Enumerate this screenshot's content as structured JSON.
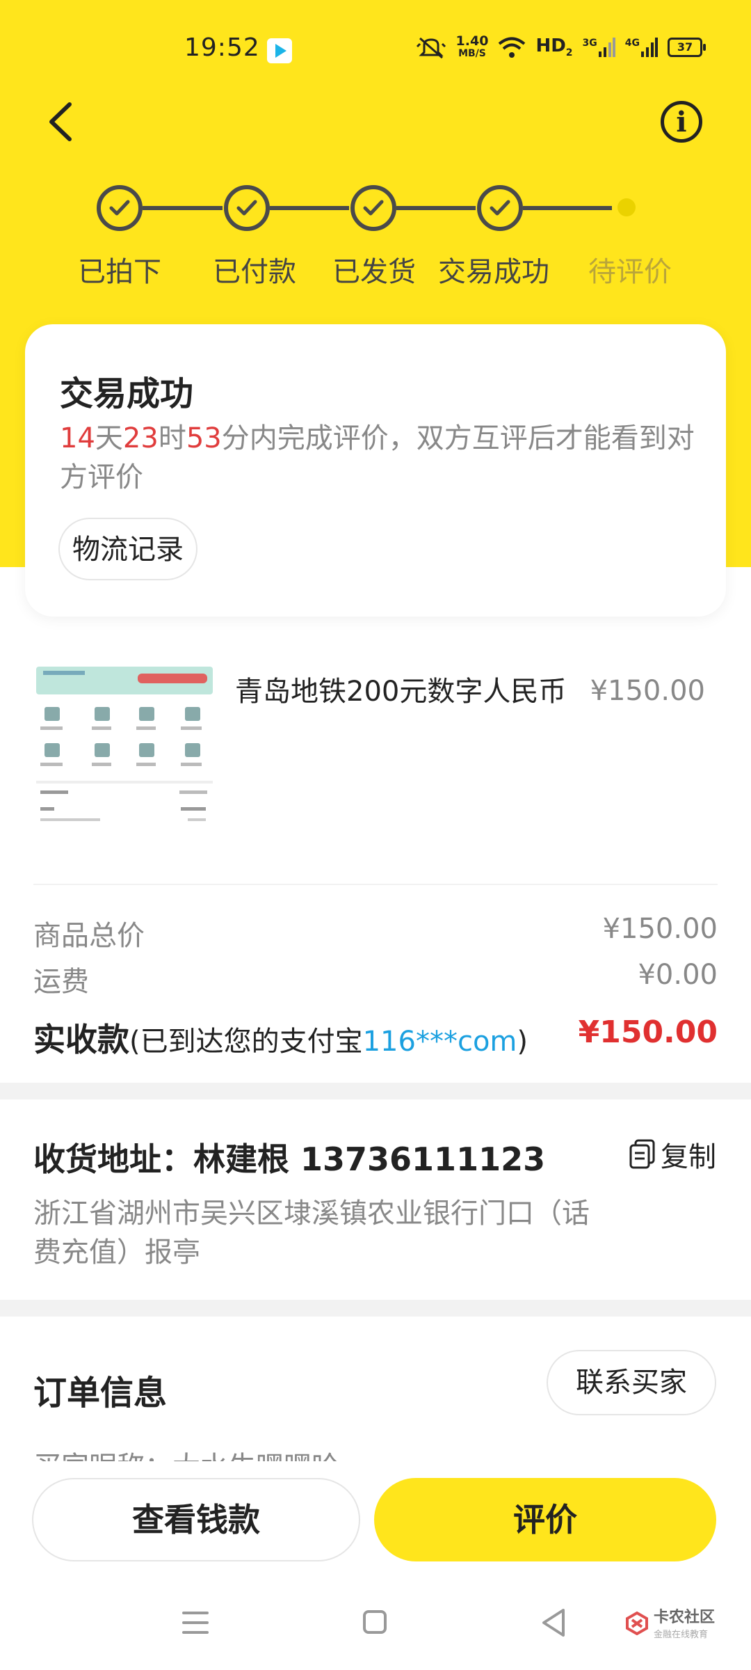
{
  "status_bar": {
    "time": "19:52",
    "net_speed_value": "1.40",
    "net_speed_unit": "MB/S",
    "hd": "HD",
    "hd_sub": "2",
    "sig1": "3G",
    "sig2": "4G",
    "battery": "37"
  },
  "progress": {
    "steps": [
      {
        "label": "已拍下",
        "done": true
      },
      {
        "label": "已付款",
        "done": true
      },
      {
        "label": "已发货",
        "done": true
      },
      {
        "label": "交易成功",
        "done": true
      },
      {
        "label": "待评价",
        "done": false
      }
    ]
  },
  "status_card": {
    "title": "交易成功",
    "days": "14",
    "days_unit": "天",
    "hours": "23",
    "hours_unit": "时",
    "minutes": "53",
    "desc_rest": "分内完成评价，双方互评后才能看到对方评价",
    "logistics_label": "物流记录"
  },
  "product": {
    "title": "青岛地铁200元数字人民币",
    "price": "¥150.00"
  },
  "pricing": {
    "total_label": "商品总价",
    "total_value": "¥150.00",
    "shipping_label": "运费",
    "shipping_value": "¥0.00",
    "received_label": "实收款",
    "received_note_prefix": "(已到达您的支付宝",
    "received_account": "116***com",
    "received_note_suffix": ")",
    "received_amount": "¥150.00"
  },
  "address": {
    "title": "收货地址：林建根  13736111123",
    "copy_label": "复制",
    "detail": "浙江省湖州市吴兴区埭溪镇农业银行门口（话费充值）报亭"
  },
  "order_info": {
    "title": "订单信息",
    "contact_label": "联系买家",
    "buyer_nick_partial": "买家昵称：大水牛嘿嘿哈"
  },
  "actions": {
    "view_money": "查看钱款",
    "rate": "评价"
  },
  "watermark": {
    "main": "卡农社区",
    "sub": "金融在线教育"
  },
  "colors": {
    "accent_yellow": "#FFE51C",
    "countdown_red": "#E03C3C",
    "amount_red": "#E03030",
    "account_blue": "#1BA0E0"
  }
}
